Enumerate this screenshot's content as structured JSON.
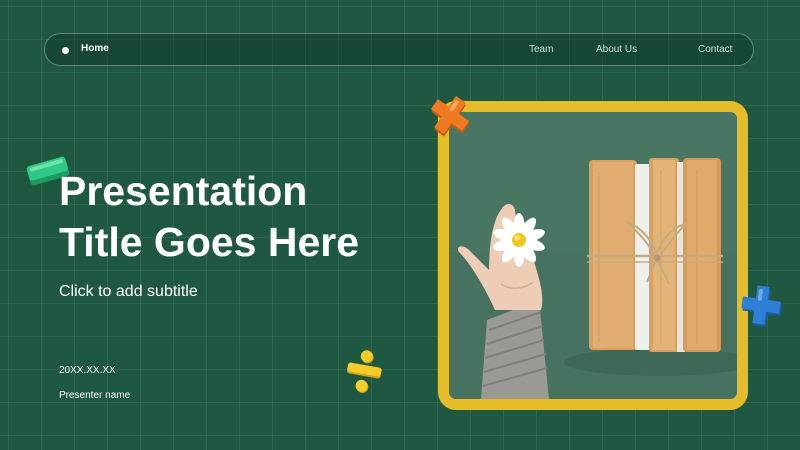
{
  "nav": {
    "home_label": "Home",
    "links": [
      "Team",
      "About Us",
      "Contact"
    ]
  },
  "slide": {
    "title_line1": "Presentation",
    "title_line2": "Title Goes Here",
    "subtitle": "Click to add subtitle",
    "date": "20XX.XX.XX",
    "presenter": "Presenter name"
  },
  "colors": {
    "background": "#1e5840",
    "frame": "#e5bc2a",
    "cross_orange": "#f07a22",
    "cross_blue": "#2f7fd6",
    "eraser": "#2ec982",
    "divide": "#f0c020"
  },
  "icons": [
    "plus-icon",
    "divide-icon",
    "eraser-icon"
  ]
}
